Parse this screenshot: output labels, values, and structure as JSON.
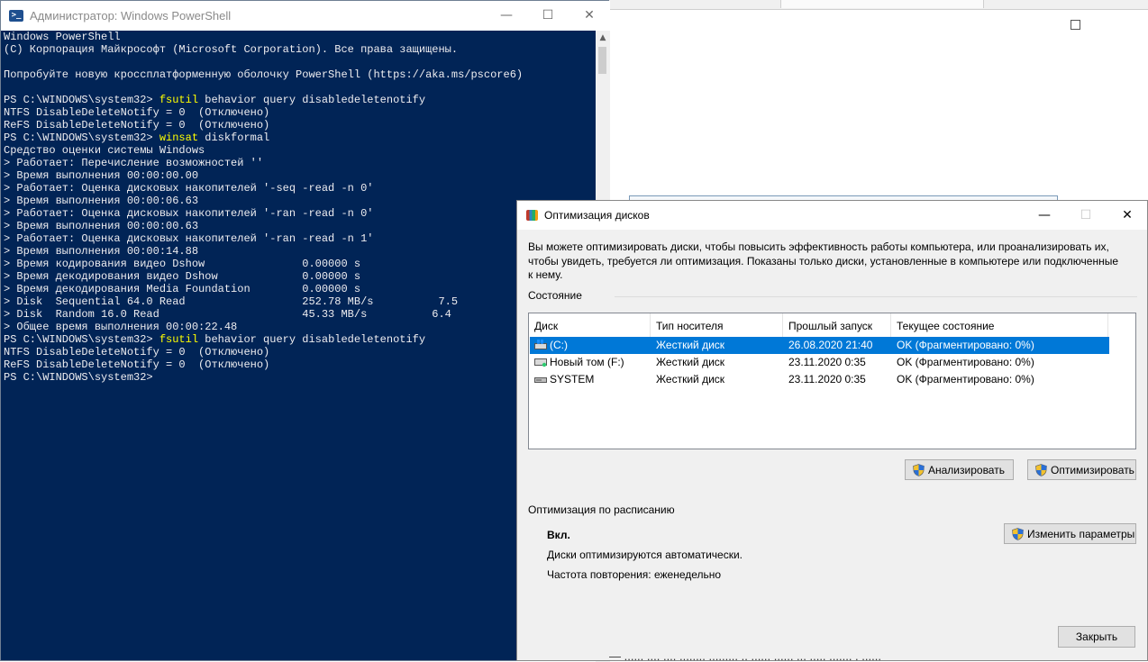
{
  "powershell": {
    "title": "Администратор: Windows PowerShell",
    "icon": "powershell-icon",
    "colors": {
      "background": "#012456",
      "text": "#eeedf0",
      "command": "#ffff00"
    },
    "lines": [
      {
        "text": "Windows PowerShell"
      },
      {
        "text": "(C) Корпорация Майкрософт (Microsoft Corporation). Все права защищены."
      },
      {
        "text": ""
      },
      {
        "text": "Попробуйте новую кроссплатформенную оболочку PowerShell (https://aka.ms/pscore6)"
      },
      {
        "text": ""
      },
      {
        "prompt": "PS C:\\WINDOWS\\system32> ",
        "cmd": "fsutil",
        "args": " behavior query disabledeletenotify"
      },
      {
        "text": "NTFS DisableDeleteNotify = 0  (Отключено)"
      },
      {
        "text": "ReFS DisableDeleteNotify = 0  (Отключено)"
      },
      {
        "prompt": "PS C:\\WINDOWS\\system32> ",
        "cmd": "winsat",
        "args": " diskformal"
      },
      {
        "text": "Средство оценки системы Windows"
      },
      {
        "text": "> Работает: Перечисление возможностей ''"
      },
      {
        "text": "> Время выполнения 00:00:00.00"
      },
      {
        "text": "> Работает: Оценка дисковых накопителей '-seq -read -n 0'"
      },
      {
        "text": "> Время выполнения 00:00:06.63"
      },
      {
        "text": "> Работает: Оценка дисковых накопителей '-ran -read -n 0'"
      },
      {
        "text": "> Время выполнения 00:00:00.63"
      },
      {
        "text": "> Работает: Оценка дисковых накопителей '-ran -read -n 1'"
      },
      {
        "text": "> Время выполнения 00:00:14.88"
      },
      {
        "text": "> Время кодирования видео Dshow               0.00000 s"
      },
      {
        "text": "> Время декодирования видео Dshow             0.00000 s"
      },
      {
        "text": "> Время декодирования Media Foundation        0.00000 s"
      },
      {
        "text": "> Disk  Sequential 64.0 Read                  252.78 MB/s          7.5"
      },
      {
        "text": "> Disk  Random 16.0 Read                      45.33 MB/s          6.4"
      },
      {
        "text": "> Общее время выполнения 00:00:22.48"
      },
      {
        "prompt": "PS C:\\WINDOWS\\system32> ",
        "cmd": "fsutil",
        "args": " behavior query disabledeletenotify"
      },
      {
        "text": "NTFS DisableDeleteNotify = 0  (Отключено)"
      },
      {
        "text": "ReFS DisableDeleteNotify = 0  (Отключено)"
      },
      {
        "text": "PS C:\\WINDOWS\\system32>"
      }
    ]
  },
  "dialog": {
    "title": "Оптимизация дисков",
    "description": "Вы можете оптимизировать диски, чтобы повысить эффективность работы  компьютера, или проанализировать их, чтобы увидеть, требуется ли оптимизация. Показаны только диски, установленные в компьютере или подключенные к нему.",
    "status_label": "Состояние",
    "columns": [
      "Диск",
      "Тип носителя",
      "Прошлый запуск",
      "Текущее состояние"
    ],
    "drives": [
      {
        "name": "(C:)",
        "media": "Жесткий диск",
        "last_run": "26.08.2020 21:40",
        "status": "OK (Фрагментировано: 0%)",
        "icon": "windows-drive-icon",
        "selected": true
      },
      {
        "name": "Новый том (F:)",
        "media": "Жесткий диск",
        "last_run": "23.11.2020 0:35",
        "status": "OK (Фрагментировано: 0%)",
        "icon": "hard-drive-icon",
        "selected": false
      },
      {
        "name": "SYSTEM",
        "media": "Жесткий диск",
        "last_run": "23.11.2020 0:35",
        "status": "OK (Фрагментировано: 0%)",
        "icon": "hard-drive-icon",
        "selected": false
      }
    ],
    "analyze_button": "Анализировать",
    "optimize_button": "Оптимизировать",
    "schedule_label": "Оптимизация по расписанию",
    "schedule_state": "Вкл.",
    "schedule_desc": "Диски оптимизируются автоматически.",
    "schedule_freq": "Частота повторения: еженедельно",
    "change_button": "Изменить параметры",
    "close_button": "Закрыть",
    "colors": {
      "selection": "#0078d7",
      "button": "#e1e1e1"
    }
  },
  "background": {
    "text": "— ...... .... .... ........ ......... .. ...... ...... ... ..... ....... . ......"
  }
}
